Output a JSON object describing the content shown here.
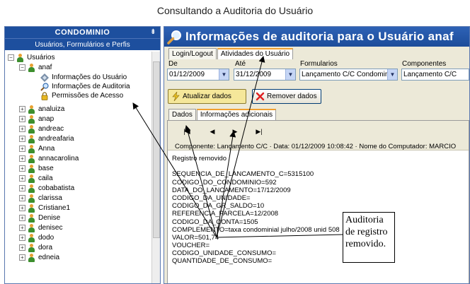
{
  "caption": "Consultando a Auditoria do Usuário",
  "sidebar": {
    "title": "CONDOMINIO",
    "subtitle": "Usuários, Formulários e Perfis",
    "root_label": "Usuários",
    "expanded_user": "anaf",
    "children": [
      "Informações do Usuário",
      "Informações de Auditoria",
      "Permissões de Acesso"
    ],
    "users": [
      "analuiza",
      "anap",
      "andreac",
      "andreafaria",
      "Anna",
      "annacarolina",
      "base",
      "caila",
      "cobabatista",
      "clarissa",
      "Cristiane1",
      "Denise",
      "denisec",
      "dodo",
      "dora",
      "edneia"
    ]
  },
  "main": {
    "title": "Informações de auditoria para o Usuário anaf",
    "tabs": [
      "Login/Logout",
      "Atividades do Usuário"
    ],
    "form": {
      "de_label": "De",
      "ate_label": "Até",
      "formularios_label": "Formularios",
      "componentes_label": "Componentes",
      "de_value": "01/12/2009",
      "ate_value": "31/12/2009",
      "formularios_value": "Lançamento C/C Condominio",
      "componentes_value": "Lançamento C/C"
    },
    "buttons": {
      "update": "Atualizar dados",
      "remove": "Remover dados"
    },
    "subtabs": [
      "Dados",
      "Informações adicionais"
    ],
    "nav": {
      "first": "|◀",
      "prev": "◀",
      "next": "▶",
      "last": "▶|"
    },
    "info_line": "Componente: Lançamento C/C · Data: 01/12/2009 10:08:42 · Nome do Computador: MARCIO",
    "log_lines": [
      "Registro removido",
      "",
      "SEQUENCIA_DE_LANCAMENTO_C=5315100",
      "CODIGO_DO_CONDOMINIO=592",
      "DATA_DO_LANCAMENTO=17/12/2009",
      "CODIGO_DA_UNIDADE=",
      "CODIGO_DA_GR_SALDO=10",
      "REFERENCIA_PARCELA=12/2008",
      "CODIGO_DA_CONTA=1505",
      "COMPLEMENTO=taxa condominial julho/2008 unid 508",
      "VALOR=501,74",
      "VOUCHER=",
      "CODIGO_UNIDADE_CONSUMO=",
      "QUANTIDADE_DE_CONSUMO="
    ]
  },
  "annotation": [
    "Auditoria",
    "de registro",
    "removido."
  ],
  "colors": {
    "header_blue": "#1d4f9e",
    "tab_accent": "#f0a030",
    "panel_bg": "#ece9d8"
  }
}
